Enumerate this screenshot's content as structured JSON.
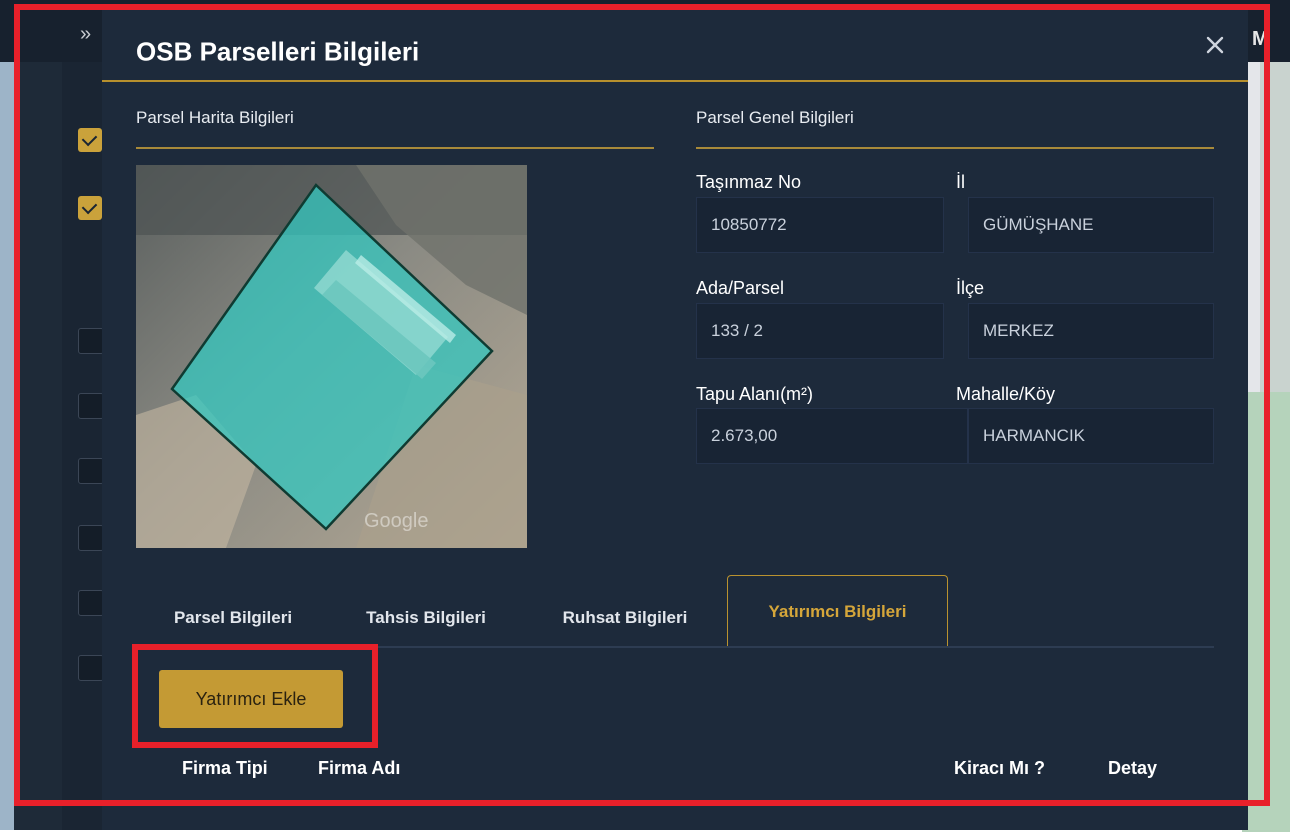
{
  "modal": {
    "title": "OSB Parselleri Bilgileri",
    "close_icon": "close-icon"
  },
  "map_section": {
    "title": "Parsel Harita Bilgileri",
    "watermark": "Google"
  },
  "general_section": {
    "title": "Parsel Genel Bilgileri",
    "fields": {
      "tasinmaz_no": {
        "label": "Taşınmaz No",
        "value": "10850772"
      },
      "il": {
        "label": "İl",
        "value": "GÜMÜŞHANE"
      },
      "ada_parsel": {
        "label": "Ada/Parsel",
        "value": "133 / 2"
      },
      "ilce": {
        "label": "İlçe",
        "value": "MERKEZ"
      },
      "tapu_alani": {
        "label": "Tapu Alanı(m²)",
        "value": "2.673,00"
      },
      "mahalle": {
        "label": "Mahalle/Köy",
        "value": "HARMANCIK"
      }
    }
  },
  "tabs": [
    {
      "label": "Parsel Bilgileri",
      "active": false
    },
    {
      "label": "Tahsis Bilgileri",
      "active": false
    },
    {
      "label": "Ruhsat Bilgileri",
      "active": false
    },
    {
      "label": "Yatırımcı Bilgileri",
      "active": true
    }
  ],
  "investor": {
    "add_button": "Yatırımcı Ekle",
    "columns": [
      "Firma Tipi",
      "Firma Adı",
      "Kiracı Mı ?",
      "Detay"
    ]
  },
  "background": {
    "partial_letter": "M",
    "chevron_icon": "double-chevron-down-icon"
  },
  "colors": {
    "accent": "#c49a34",
    "modal_bg": "#1d2a3b",
    "annotation": "#e8202a"
  }
}
